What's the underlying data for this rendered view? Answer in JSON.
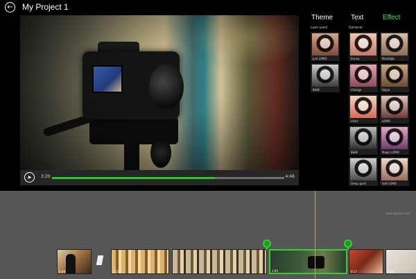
{
  "header": {
    "title": "My Project 1"
  },
  "player": {
    "current_time": "3:20",
    "total_time": "4:46",
    "progress_percent": 70
  },
  "panel": {
    "tabs": [
      {
        "label": "Theme",
        "active": false
      },
      {
        "label": "Text",
        "active": false
      },
      {
        "label": "Effect",
        "active": true
      }
    ],
    "last_used_label": "Last used",
    "general_label": "General",
    "last_used": [
      {
        "name": "Just LOMO"
      },
      {
        "name": "B&W"
      }
    ],
    "general": [
      {
        "name": "Sunny"
      },
      {
        "name": "Nostalgic"
      },
      {
        "name": "Vintage"
      },
      {
        "name": "Sepia"
      },
      {
        "name": "Vivid"
      },
      {
        "name": "LOMO"
      },
      {
        "name": "B&W"
      },
      {
        "name": "Magic LOMO"
      },
      {
        "name": "Deep sport"
      },
      {
        "name": "Soft LOMO"
      }
    ]
  },
  "timeline": {
    "clips": [
      {
        "label": "0:09"
      },
      {
        "label": ""
      },
      {
        "label": "1:22"
      },
      {
        "label": "1:05"
      },
      {
        "label": "0:17"
      },
      {
        "label": "0:14"
      }
    ],
    "watermark": "www.wpxbox.com"
  },
  "colors": {
    "accent_green": "#2ed12e",
    "effect_tab": "#3be83b",
    "timeline_bg": "#565656"
  }
}
